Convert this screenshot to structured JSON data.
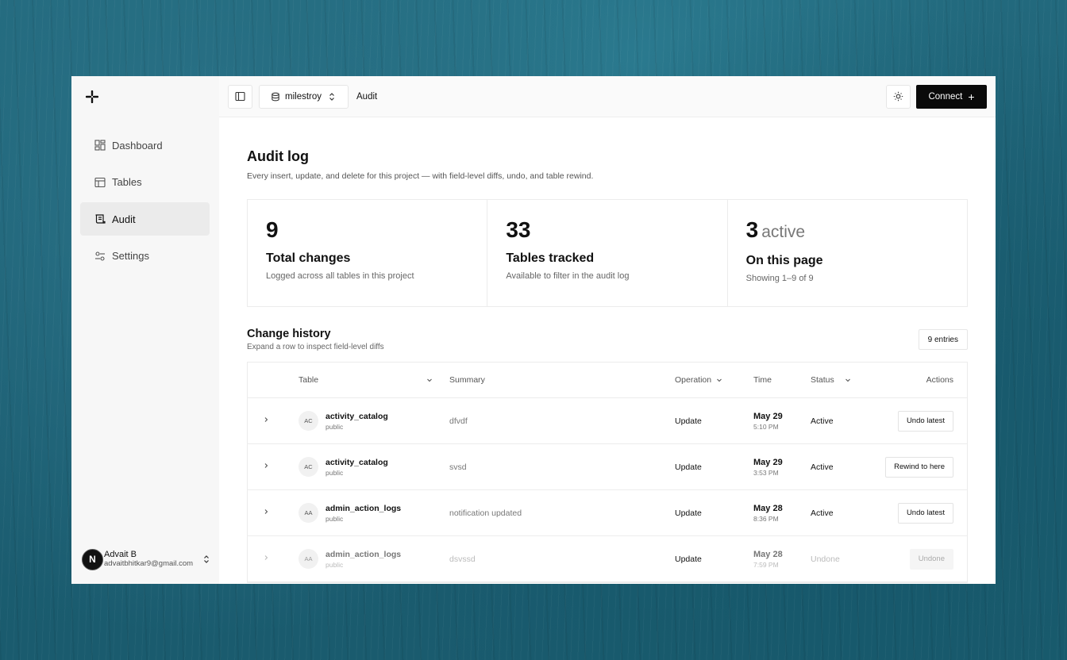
{
  "sidebar": {
    "items": [
      {
        "label": "Dashboard",
        "icon": "dashboard-icon"
      },
      {
        "label": "Tables",
        "icon": "table-icon"
      },
      {
        "label": "Audit",
        "icon": "scroll-icon",
        "active": true
      },
      {
        "label": "Settings",
        "icon": "sliders-icon"
      }
    ],
    "user": {
      "initial": "N",
      "name": "Advait B",
      "email": "advaitbhitkar9@gmail.com"
    }
  },
  "topbar": {
    "project": "milestroy",
    "breadcrumb": "Audit",
    "connect_label": "Connect"
  },
  "page": {
    "title": "Audit log",
    "description": "Every insert, update, and delete for this project — with field-level diffs, undo, and table rewind."
  },
  "stats": [
    {
      "value": "9",
      "suffix": "",
      "title": "Total changes",
      "subtitle": "Logged across all tables in this project"
    },
    {
      "value": "33",
      "suffix": "",
      "title": "Tables tracked",
      "subtitle": "Available to filter in the audit log"
    },
    {
      "value": "3",
      "suffix": "active",
      "title": "On this page",
      "subtitle": "Showing 1–9 of 9"
    }
  ],
  "history": {
    "title": "Change history",
    "subtitle": "Expand a row to inspect field-level diffs",
    "entries_label": "9 entries",
    "columns": {
      "table": "Table",
      "summary": "Summary",
      "operation": "Operation",
      "time": "Time",
      "status": "Status",
      "actions": "Actions"
    },
    "rows": [
      {
        "badge": "AC",
        "table": "activity_catalog",
        "schema": "public",
        "summary": "dfvdf",
        "operation": "Update",
        "date": "May 29",
        "time": "5:10 PM",
        "status": "Active",
        "action": "Undo latest"
      },
      {
        "badge": "AC",
        "table": "activity_catalog",
        "schema": "public",
        "summary": "svsd",
        "operation": "Update",
        "date": "May 29",
        "time": "3:53 PM",
        "status": "Active",
        "action": "Rewind to here"
      },
      {
        "badge": "AA",
        "table": "admin_action_logs",
        "schema": "public",
        "summary": "notification updated",
        "operation": "Update",
        "date": "May 28",
        "time": "8:36 PM",
        "status": "Active",
        "action": "Undo latest"
      },
      {
        "badge": "AA",
        "table": "admin_action_logs",
        "schema": "public",
        "summary": "dsvssd",
        "operation": "Update",
        "date": "May 28",
        "time": "7:59 PM",
        "status": "Undone",
        "action": "Undone"
      }
    ]
  }
}
